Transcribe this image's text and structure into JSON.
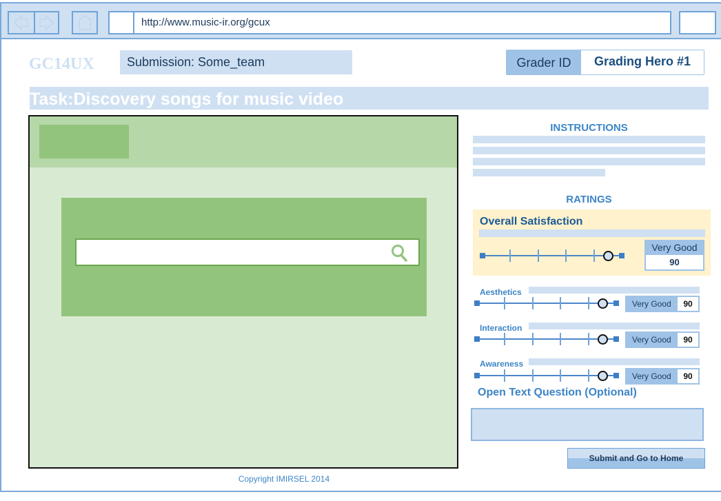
{
  "browser": {
    "url": "http://www.music-ir.org/gcux",
    "icons": [
      "back-arrow-icon",
      "forward-arrow-icon",
      "home-icon"
    ]
  },
  "header": {
    "logo": "GC14UX",
    "submission": "Submission: Some_team",
    "grader_label": "Grader ID",
    "grader_value": "Grading Hero #1",
    "task": "Task:Discovery songs for music video"
  },
  "preview": {
    "search_placeholder": "",
    "search_icon": "search-icon"
  },
  "instructions": {
    "title": "INSTRUCTIONS"
  },
  "ratings": {
    "title": "RATINGS",
    "overall": {
      "label": "Overall Satisfaction",
      "rating_text": "Very Good",
      "value": "90",
      "slider_fraction": 0.9
    },
    "criteria": [
      {
        "label": "Aesthetics",
        "rating_text": "Very Good",
        "value": "90",
        "slider_fraction": 0.9
      },
      {
        "label": "Interaction",
        "rating_text": "Very Good",
        "value": "90",
        "slider_fraction": 0.9
      },
      {
        "label": "Awareness",
        "rating_text": "Very Good",
        "value": "90",
        "slider_fraction": 0.9
      }
    ]
  },
  "open_text": {
    "title": "Open Text Question (Optional)",
    "value": ""
  },
  "submit_label": "Submit and Go to Home",
  "footer": {
    "copyright": "Copyright IMIRSEL 2014"
  }
}
